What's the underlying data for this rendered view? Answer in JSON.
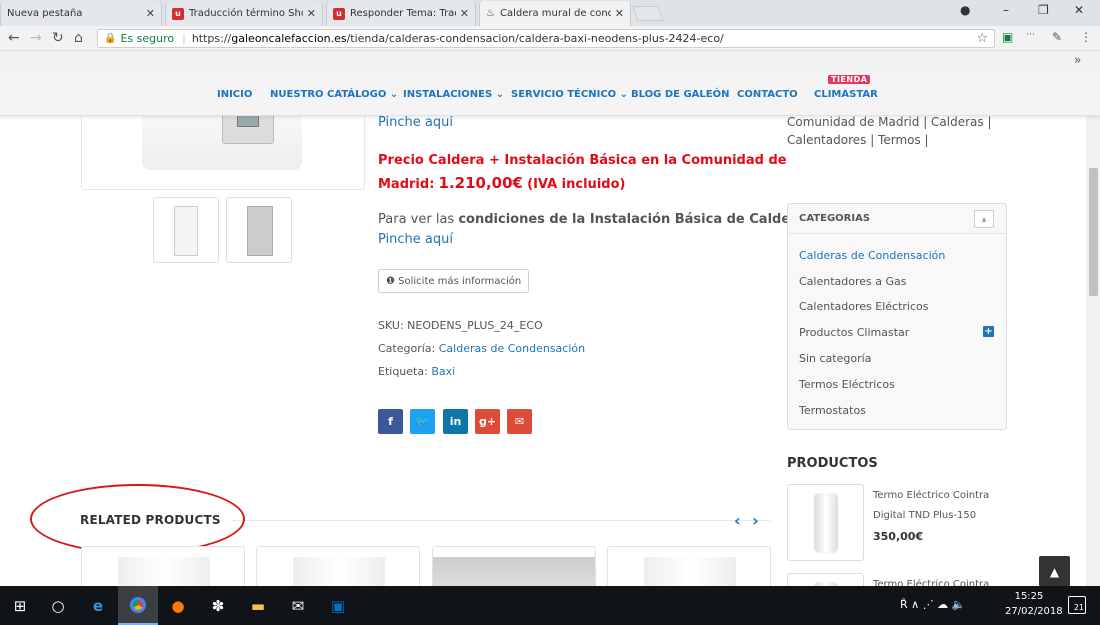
{
  "browser": {
    "tabs": [
      {
        "label": "Nueva pestaña",
        "favicon": ""
      },
      {
        "label": "Traducción término Show",
        "favicon": "u"
      },
      {
        "label": "Responder Tema: Traduc",
        "favicon": "u"
      },
      {
        "label": "Caldera mural de conden",
        "favicon": "♨"
      }
    ],
    "secure_label": "Es seguro",
    "url_prefix": "https://",
    "url_host": "galeoncalefaccion.es",
    "url_path": "/tienda/calderas-condensacion/caldera-baxi-neodens-plus-2424-eco/",
    "more_bookmarks": "»"
  },
  "site_nav": {
    "items": [
      "INICIO",
      "NUESTRO CATÁLOGO ⌄",
      "INSTALACIONES ⌄",
      "SERVICIO TÉCNICO ⌄",
      "BLOG DE GALEÓN",
      "CONTACTO",
      "CLIMASTAR"
    ],
    "tienda_badge": "TIENDA"
  },
  "product": {
    "pinche_top": "Pinche aquí",
    "price_line1": "Precio Caldera + Instalación Básica en la Comunidad de",
    "price_line2_prefix": "Madrid:",
    "price_value": "1.210,00€",
    "price_suffix": "(IVA incluido)",
    "cond_prefix": "Para ver las",
    "cond_bold": "condiciones de la Instalación Básica de Caldera",
    "cond_suffix": ".",
    "pinche_bottom": "Pinche aquí",
    "info_button": "❶ Solicite más información",
    "sku_label": "SKU:",
    "sku_value": "NEODENS_PLUS_24_ECO",
    "category_label": "Categoría:",
    "category_value": "Calderas de Condensación",
    "tag_label": "Etiqueta:",
    "tag_value": "Baxi"
  },
  "share_buttons": [
    {
      "icon": "f",
      "name": "facebook",
      "color": "#3b5998"
    },
    {
      "icon": "🐦",
      "name": "twitter",
      "color": "#1da1f2"
    },
    {
      "icon": "in",
      "name": "linkedin",
      "color": "#0e76a8"
    },
    {
      "icon": "g+",
      "name": "google-plus",
      "color": "#dd4b39"
    },
    {
      "icon": "✉",
      "name": "email",
      "color": "#dd4b39"
    }
  ],
  "related": {
    "title": "RELATED PRODUCTS",
    "arrows": "‹ ›"
  },
  "sidebar": {
    "top_line1": "Comunidad de Madrid | Calderas |",
    "top_line2": "Calentadores | Termos |",
    "categories_title": "CATEGORIAS",
    "categories": [
      "Calderas de Condensación",
      "Calentadores a Gas",
      "Calentadores Eléctricos",
      "Productos Climastar",
      "Sin categoría",
      "Termos Eléctricos",
      "Termostatos"
    ],
    "products_title": "PRODUCTOS",
    "product1_line1": "Termo Eléctrico Cointra",
    "product1_line2": "Digital TND Plus-150",
    "product1_price": "350,00€",
    "product2_line1": "Termo Eléctrico Cointra"
  },
  "taskbar": {
    "time": "15:25",
    "date": "27/02/2018",
    "notifications": "21",
    "tray_icons": "Ȓ ∧ ⋰ ☁ 🔈"
  },
  "colors": {
    "link": "#1e73be",
    "price_red": "#e30b17",
    "annotation_red": "#d51818"
  }
}
